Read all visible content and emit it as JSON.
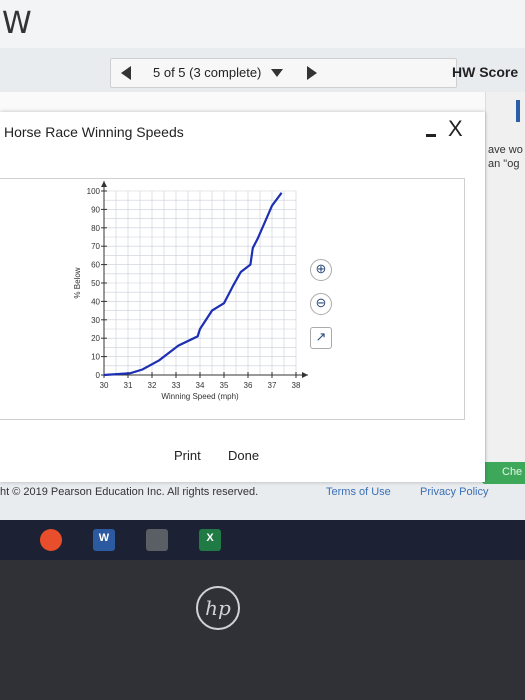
{
  "app_letter": "W",
  "question_nav": {
    "label": "5 of 5 (3 complete)"
  },
  "hw_score": "HW Score",
  "side_text": {
    "line1": "ave wo",
    "line2": "an \"og"
  },
  "check_button": "Che",
  "dialog": {
    "title": "Horse Race Winning Speeds",
    "close_symbol": "X",
    "print_label": "Print",
    "done_label": "Done",
    "tools": [
      "zoom-in-icon",
      "zoom-out-icon",
      "popout-icon"
    ]
  },
  "footer": {
    "copyright": "ht © 2019 Pearson Education Inc. All rights reserved.",
    "terms": "Terms of Use",
    "privacy": "Privacy Policy"
  },
  "taskbar": {
    "icons": [
      "chrome-icon",
      "word-icon",
      "calculator-icon",
      "excel-icon"
    ]
  },
  "bezel_logo": "hp",
  "chart_data": {
    "type": "line",
    "title": "",
    "xlabel": "Winning Speed (mph)",
    "ylabel": "% Below",
    "xlim": [
      30,
      38
    ],
    "ylim": [
      0,
      100
    ],
    "x_ticks": [
      30,
      31,
      32,
      33,
      34,
      35,
      36,
      37,
      38
    ],
    "y_ticks": [
      0,
      10,
      20,
      30,
      40,
      50,
      60,
      70,
      80,
      90,
      100
    ],
    "grid": true,
    "color": "#1d2fb3",
    "series": [
      {
        "x": [
          30.0,
          31.1,
          31.6,
          32.3,
          32.9,
          33.1,
          33.9,
          34.0,
          34.5,
          35.0,
          35.4,
          35.7,
          36.1,
          36.2,
          36.4,
          36.8,
          37.0,
          37.4
        ],
        "y": [
          0,
          1,
          3,
          8,
          14,
          16,
          21,
          25,
          35,
          39,
          49,
          56,
          60,
          69,
          74,
          86,
          92,
          99
        ]
      }
    ]
  }
}
